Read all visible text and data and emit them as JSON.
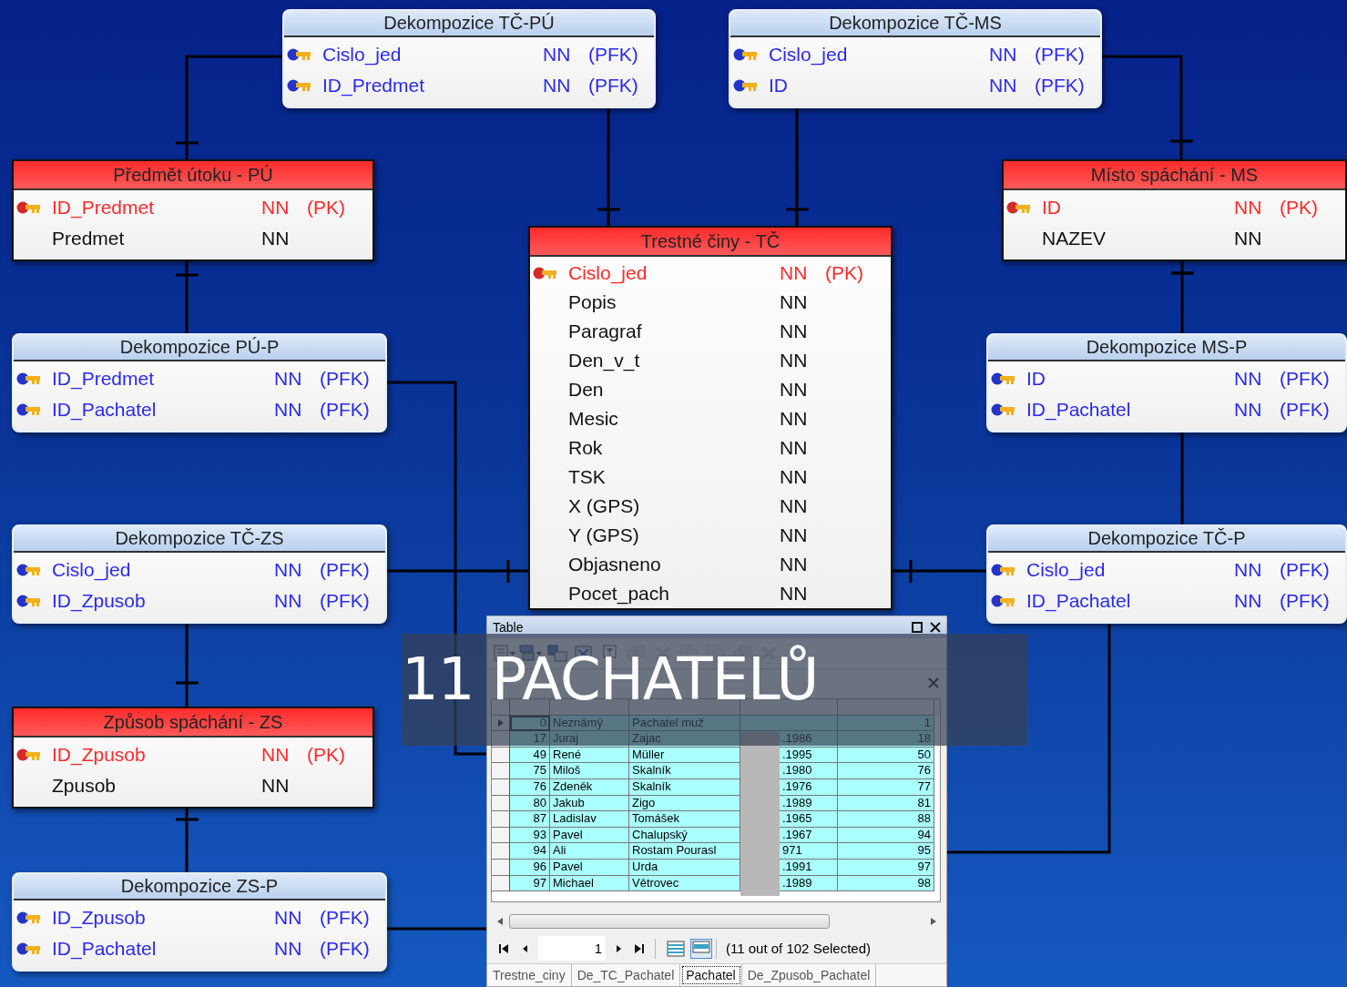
{
  "diagram": {
    "entities": [
      {
        "kind": "link",
        "title": "Dekompozice TČ-PÚ",
        "columns": [
          {
            "kind": "pfk",
            "name": "Cislo_jed",
            "null": "NN",
            "key": "(PFK)"
          },
          {
            "kind": "pfk",
            "name": "ID_Predmet",
            "null": "NN",
            "key": "(PFK)"
          }
        ]
      },
      {
        "kind": "link",
        "title": "Dekompozice TČ-MS",
        "columns": [
          {
            "kind": "pfk",
            "name": "Cislo_jed",
            "null": "NN",
            "key": "(PFK)"
          },
          {
            "kind": "pfk",
            "name": "ID",
            "null": "NN",
            "key": "(PFK)"
          }
        ]
      },
      {
        "kind": "entity",
        "title": "Předmět útoku - PÚ",
        "columns": [
          {
            "kind": "pk",
            "name": "ID_Predmet",
            "null": "NN",
            "key": "(PK)"
          },
          {
            "kind": "plain",
            "name": "Predmet",
            "null": "NN"
          }
        ]
      },
      {
        "kind": "entity",
        "title": "Místo spáchání - MS",
        "columns": [
          {
            "kind": "pk",
            "name": "ID",
            "null": "NN",
            "key": "(PK)"
          },
          {
            "kind": "plain",
            "name": "NAZEV",
            "null": "NN"
          }
        ]
      },
      {
        "kind": "entity",
        "title": "Trestné činy - TČ",
        "columns": [
          {
            "kind": "pk",
            "name": "Cislo_jed",
            "null": "NN",
            "key": "(PK)"
          },
          {
            "kind": "plain",
            "name": "Popis",
            "null": "NN"
          },
          {
            "kind": "plain",
            "name": "Paragraf",
            "null": "NN"
          },
          {
            "kind": "plain",
            "name": "Den_v_t",
            "null": "NN"
          },
          {
            "kind": "plain",
            "name": "Den",
            "null": "NN"
          },
          {
            "kind": "plain",
            "name": "Mesic",
            "null": "NN"
          },
          {
            "kind": "plain",
            "name": "Rok",
            "null": "NN"
          },
          {
            "kind": "plain",
            "name": "TSK",
            "null": "NN"
          },
          {
            "kind": "plain",
            "name": "X (GPS)",
            "null": "NN"
          },
          {
            "kind": "plain",
            "name": "Y (GPS)",
            "null": "NN"
          },
          {
            "kind": "plain",
            "name": "Objasneno",
            "null": "NN"
          },
          {
            "kind": "plain",
            "name": "Pocet_pach",
            "null": "NN"
          }
        ]
      },
      {
        "kind": "link",
        "title": "Dekompozice PÚ-P",
        "columns": [
          {
            "kind": "pfk",
            "name": "ID_Predmet",
            "null": "NN",
            "key": "(PFK)"
          },
          {
            "kind": "pfk",
            "name": "ID_Pachatel",
            "null": "NN",
            "key": "(PFK)"
          }
        ]
      },
      {
        "kind": "link",
        "title": "Dekompozice MS-P",
        "columns": [
          {
            "kind": "pfk",
            "name": "ID",
            "null": "NN",
            "key": "(PFK)"
          },
          {
            "kind": "pfk",
            "name": "ID_Pachatel",
            "null": "NN",
            "key": "(PFK)"
          }
        ]
      },
      {
        "kind": "link",
        "title": "Dekompozice TČ-ZS",
        "columns": [
          {
            "kind": "pfk",
            "name": "Cislo_jed",
            "null": "NN",
            "key": "(PFK)"
          },
          {
            "kind": "pfk",
            "name": "ID_Zpusob",
            "null": "NN",
            "key": "(PFK)"
          }
        ]
      },
      {
        "kind": "link",
        "title": "Dekompozice TČ-P",
        "columns": [
          {
            "kind": "pfk",
            "name": "Cislo_jed",
            "null": "NN",
            "key": "(PFK)"
          },
          {
            "kind": "pfk",
            "name": "ID_Pachatel",
            "null": "NN",
            "key": "(PFK)"
          }
        ]
      },
      {
        "kind": "entity",
        "title": "Způsob spáchání - ZS",
        "columns": [
          {
            "kind": "pk",
            "name": "ID_Zpusob",
            "null": "NN",
            "key": "(PK)"
          },
          {
            "kind": "plain",
            "name": "Zpusob",
            "null": "NN"
          }
        ]
      },
      {
        "kind": "link",
        "title": "Dekompozice ZS-P",
        "columns": [
          {
            "kind": "pfk",
            "name": "ID_Zpusob",
            "null": "NN",
            "key": "(PFK)"
          },
          {
            "kind": "pfk",
            "name": "ID_Pachatel",
            "null": "NN",
            "key": "(PFK)"
          }
        ]
      }
    ]
  },
  "table_window": {
    "title": "Table",
    "toolbar": [
      {
        "kind": "options",
        "disabled": false
      },
      {
        "kind": "related",
        "disabled": false
      },
      {
        "kind": "select",
        "disabled": false
      },
      {
        "kind": "switch",
        "disabled": false
      },
      {
        "kind": "clear",
        "disabled": false
      },
      {
        "kind": "zoom",
        "disabled": true
      },
      {
        "kind": "delete",
        "disabled": true
      },
      {
        "kind": "copy",
        "disabled": true
      },
      {
        "kind": "copy",
        "disabled": true
      },
      {
        "kind": "zoom",
        "disabled": true
      },
      {
        "kind": "delete",
        "disabled": true
      }
    ],
    "rows": [
      {
        "id": "0",
        "first": "Neznámý",
        "last": "Pachatel muž",
        "date": "",
        "ref": "1",
        "selected": true,
        "current": true
      },
      {
        "id": "17",
        "first": "Juraj",
        "last": "Zajac",
        "date": ".1986",
        "ref": "18",
        "selected": true,
        "current": false
      },
      {
        "id": "49",
        "first": "René",
        "last": "Müller",
        "date": ".1995",
        "ref": "50",
        "selected": true,
        "current": false
      },
      {
        "id": "75",
        "first": "Miloš",
        "last": "Skalník",
        "date": ".1980",
        "ref": "76",
        "selected": true,
        "current": false
      },
      {
        "id": "76",
        "first": "Zdeněk",
        "last": "Skalník",
        "date": ".1976",
        "ref": "77",
        "selected": true,
        "current": false
      },
      {
        "id": "80",
        "first": "Jakub",
        "last": "Zigo",
        "date": ".1989",
        "ref": "81",
        "selected": true,
        "current": false
      },
      {
        "id": "87",
        "first": "Ladislav",
        "last": "Tomášek",
        "date": ".1965",
        "ref": "88",
        "selected": true,
        "current": false
      },
      {
        "id": "93",
        "first": "Pavel",
        "last": "Chalupský",
        "date": ".1967",
        "ref": "94",
        "selected": true,
        "current": false
      },
      {
        "id": "94",
        "first": "Ali",
        "last": "Rostam Pourasl",
        "date": "971",
        "ref": "95",
        "selected": true,
        "current": false
      },
      {
        "id": "96",
        "first": "Pavel",
        "last": "Urda",
        "date": ".1991",
        "ref": "97",
        "selected": true,
        "current": false
      },
      {
        "id": "97",
        "first": "Michael",
        "last": "Větrovec",
        "date": ".1989",
        "ref": "98",
        "selected": true,
        "current": false
      }
    ],
    "page": "1",
    "view_buttons": [
      {
        "selected": false
      },
      {
        "selected": true
      }
    ],
    "status": "(11 out of 102 Selected)",
    "tabs": [
      {
        "label": "Trestne_ciny",
        "selected": false
      },
      {
        "label": "De_TC_Pachatel",
        "selected": false
      },
      {
        "label": "Pachatel",
        "selected": true
      },
      {
        "label": "De_Zpusob_Pachatel",
        "selected": false
      }
    ]
  },
  "banner": {
    "text": "11 PACHATELŮ"
  }
}
